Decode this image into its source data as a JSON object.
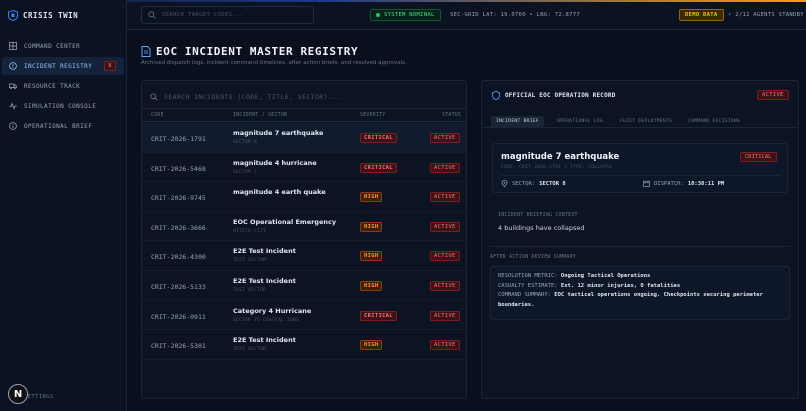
{
  "app": {
    "title": "CRISIS TWIN"
  },
  "sidebar": {
    "items": [
      {
        "label": "COMMAND CENTER"
      },
      {
        "label": "INCIDENT REGISTRY",
        "badge": "8"
      },
      {
        "label": "RESOURCE TRACK"
      },
      {
        "label": "SIMULATION CONSOLE"
      },
      {
        "label": "OPERATIONAL BRIEF"
      }
    ],
    "avatar": "N",
    "settings": "SETTINGS"
  },
  "topbar": {
    "search_placeholder": "SEARCH TARGET CODES...",
    "system_status": "SYSTEM NOMINAL",
    "coords": "SEC-GRID LAT: 19.0760 • LNG: 72.8777",
    "demo_label": "DEMO DATA",
    "agents": "2/12 AGENTS STANDBY"
  },
  "page": {
    "title": "EOC INCIDENT MASTER REGISTRY",
    "subtitle": "Archived dispatch logs, incident command timelines, after action briefs, and resolved approvals."
  },
  "registry": {
    "search_placeholder": "SEARCH INCIDENTS (CODE, TITLE, SECTOR)...",
    "columns": {
      "code": "CODE",
      "incident": "INCIDENT / SECTOR",
      "severity": "SEVERITY",
      "status": "STATUS"
    },
    "rows": [
      {
        "code": "CRIT-2026-1791",
        "title": "magnitude 7 earthquake",
        "sector": "SECTOR 8",
        "severity": "CRITICAL",
        "sev_class": "critical",
        "status": "ACTIVE"
      },
      {
        "code": "CRIT-2026-5468",
        "title": "magnitude 4 hurricane",
        "sector": "SECTOR 7",
        "severity": "CRITICAL",
        "sev_class": "critical",
        "status": "ACTIVE"
      },
      {
        "code": "CRIT-2026-9745",
        "title": "magnitude 4 earth quake",
        "sector": "",
        "severity": "HIGH",
        "sev_class": "high",
        "status": "ACTIVE"
      },
      {
        "code": "CRIT-2026-3666",
        "title": "EOC Operational Emergency",
        "sector": "HITECH CITY",
        "severity": "HIGH",
        "sev_class": "high",
        "status": "ACTIVE"
      },
      {
        "code": "CRIT-2026-4300",
        "title": "E2E Test Incident",
        "sector": "TEST SECTOR",
        "severity": "HIGH",
        "sev_class": "high",
        "status": "ACTIVE"
      },
      {
        "code": "CRIT-2026-5133",
        "title": "E2E Test Incident",
        "sector": "TEST SECTOR",
        "severity": "HIGH",
        "sev_class": "high",
        "status": "ACTIVE"
      },
      {
        "code": "CRIT-2026-0911",
        "title": "Category 4 Hurricane",
        "sector": "SECTOR 7G COASTAL ZONE",
        "severity": "CRITICAL",
        "sev_class": "critical",
        "status": "ACTIVE"
      },
      {
        "code": "CRIT-2026-5301",
        "title": "E2E Test Incident",
        "sector": "TEST SECTOR",
        "severity": "HIGH",
        "sev_class": "high",
        "status": "ACTIVE"
      }
    ]
  },
  "record": {
    "header": "OFFICIAL EOC OPERATION RECORD",
    "status": "ACTIVE",
    "tabs": [
      "INCIDENT BRIEF",
      "OPERATIONAL LOG",
      "FLEET DEPLOYMENTS",
      "COMMAND DECISIONS"
    ],
    "title": "magnitude 7 earthquake",
    "severity": "CRITICAL",
    "code_line": "CODE: CRIT-2026-1791 • TYPE: COLLAPSE",
    "sector_label": "SECTOR:",
    "sector_value": "SECTOR 8",
    "dispatch_label": "DISPATCH:",
    "dispatch_value": "10:38:11 PM",
    "context_label": "INCIDENT BRIEFING CONTEXT",
    "context_value": "4 buildings have collapsed",
    "aar_label": "AFTER ACTION REVIEW SUMMARY",
    "resolution_label": "RESOLUTION METRIC:",
    "resolution_value": "Ongoing Tactical Operations",
    "casualty_label": "CASUALTY ESTIMATE:",
    "casualty_value": "Est. 12 minor injuries, 0 fatalities",
    "command_label": "COMMAND SUMMARY:",
    "command_value": "EOC tactical operations ongoing. Checkpoints securing perimeter boundaries."
  }
}
